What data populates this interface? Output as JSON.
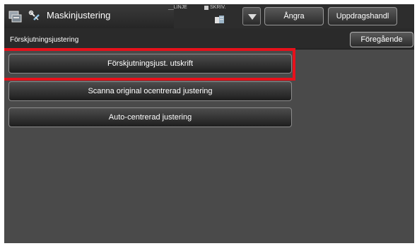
{
  "header": {
    "title": "Maskinjustering",
    "icons": {
      "app": "machine-settings-icon",
      "tool": "adjustment-tool-icon",
      "job": "job-status-icon",
      "dropdown": "triangle-down-icon"
    },
    "status": {
      "linje": "__LINJE",
      "skriv": "SKRIV."
    },
    "undo_label": "Ångra",
    "job_label": "Uppdragshandl"
  },
  "subheader": {
    "title": "Förskjutningsjustering",
    "back_label": "Föregående"
  },
  "options": [
    {
      "label": "Förskjutningsjust. utskrift",
      "selected": true
    },
    {
      "label": "Scanna original ocentrerad justering",
      "selected": false
    },
    {
      "label": "Auto-centrerad justering",
      "selected": false
    }
  ],
  "colors": {
    "highlight": "#e8111b",
    "background": "#4a4a4a"
  }
}
